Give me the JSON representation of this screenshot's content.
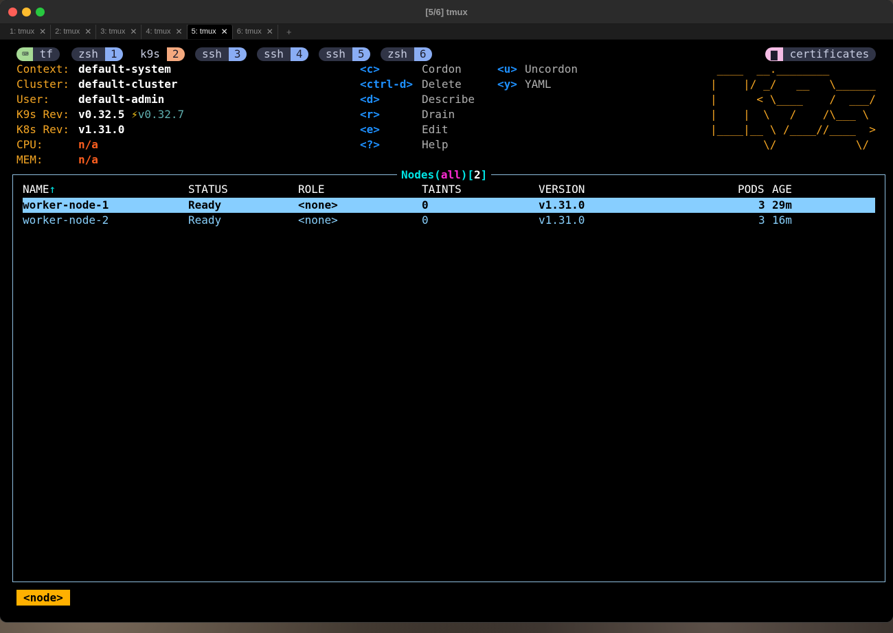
{
  "window": {
    "title": "[5/6] tmux"
  },
  "terminal_tabs": [
    {
      "label": "1: tmux",
      "active": false
    },
    {
      "label": "2: tmux",
      "active": false
    },
    {
      "label": "3: tmux",
      "active": false
    },
    {
      "label": "4: tmux",
      "active": false
    },
    {
      "label": "5: tmux",
      "active": true
    },
    {
      "label": "6: tmux",
      "active": false
    }
  ],
  "tab_close_glyph": "✕",
  "new_tab_glyph": "+",
  "tmux": {
    "session": "tf",
    "session_icon": "⌨",
    "windows": [
      {
        "name": "zsh",
        "num": "1"
      },
      {
        "name": "k9s",
        "num": "2"
      },
      {
        "name": "ssh",
        "num": "3"
      },
      {
        "name": "ssh",
        "num": "4"
      },
      {
        "name": "ssh",
        "num": "5"
      },
      {
        "name": "zsh",
        "num": "6"
      }
    ],
    "directory": "certificates",
    "directory_icon": "▆"
  },
  "colors": {
    "accent_orange": "#f5a623",
    "highlight_row": "#87ceff",
    "active_window": "#f5a97f"
  },
  "info": {
    "context_label": "Context:",
    "context": "default-system",
    "cluster_label": "Cluster:",
    "cluster": "default-cluster",
    "user_label": "User:",
    "user": "default-admin",
    "k9s_label": "K9s Rev:",
    "k9s_rev": "v0.32.5",
    "k9s_bolt": "⚡",
    "k9s_latest": "v0.32.7",
    "k8s_label": "K8s Rev:",
    "k8s_rev": "v1.31.0",
    "cpu_label": "CPU:",
    "cpu": "n/a",
    "mem_label": "MEM:",
    "mem": "n/a"
  },
  "shortcuts": [
    {
      "key": "<c>",
      "action": "Cordon"
    },
    {
      "key": "<ctrl-d>",
      "action": "Delete"
    },
    {
      "key": "<d>",
      "action": "Describe"
    },
    {
      "key": "<r>",
      "action": "Drain"
    },
    {
      "key": "<e>",
      "action": "Edit"
    },
    {
      "key": "<?>",
      "action": "Help"
    },
    {
      "key": "<u>",
      "action": "Uncordon"
    },
    {
      "key": "<y>",
      "action": "YAML"
    }
  ],
  "logo": [
    " ____  __.________       ",
    "|    |/ _/   __   \\______",
    "|      < \\____    /  ___/",
    "|    |  \\   /    /\\___ \\ ",
    "|____|__ \\ /____//____  >",
    "        \\/            \\/ "
  ],
  "table": {
    "title_resource": "Nodes",
    "title_filter": "all",
    "title_count": "2",
    "columns": [
      "NAME",
      "STATUS",
      "ROLE",
      "TAINTS",
      "VERSION",
      "PODS",
      "AGE"
    ],
    "sort_arrow": "↑",
    "rows": [
      {
        "name": "worker-node-1",
        "status": "Ready",
        "role": "<none>",
        "taints": "0",
        "version": "v1.31.0",
        "pods": "3",
        "age": "29m",
        "selected": true
      },
      {
        "name": "worker-node-2",
        "status": "Ready",
        "role": "<none>",
        "taints": "0",
        "version": "v1.31.0",
        "pods": "3",
        "age": "16m",
        "selected": false
      }
    ]
  },
  "breadcrumb": "<node>"
}
